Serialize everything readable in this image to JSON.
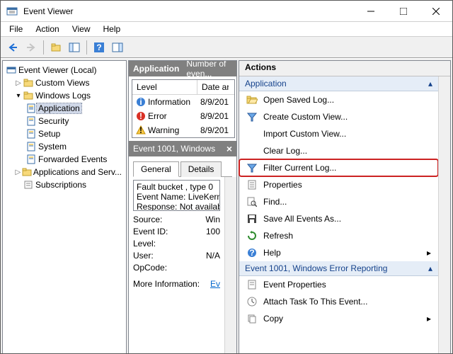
{
  "window": {
    "title": "Event Viewer"
  },
  "menu": {
    "file": "File",
    "action": "Action",
    "view": "View",
    "help": "Help"
  },
  "tree": {
    "root": "Event Viewer (Local)",
    "custom_views": "Custom Views",
    "windows_logs": "Windows Logs",
    "application": "Application",
    "security": "Security",
    "setup": "Setup",
    "system": "System",
    "forwarded": "Forwarded Events",
    "apps_services": "Applications and Serv...",
    "subscriptions": "Subscriptions"
  },
  "mid": {
    "header_title": "Application",
    "header_sub": "Number of even...",
    "col_level": "Level",
    "col_date": "Date ar",
    "rows": [
      {
        "level": "Information",
        "date": "8/9/201"
      },
      {
        "level": "Error",
        "date": "8/9/201"
      },
      {
        "level": "Warning",
        "date": "8/9/201"
      }
    ],
    "detail_title": "Event 1001, Windows",
    "tab_general": "General",
    "tab_details": "Details",
    "detail_lines": {
      "l1": "Fault bucket , type 0",
      "l2": "Event Name: LiveKerne",
      "l3": "Response: Not availabl"
    },
    "kv": {
      "source_k": "Source:",
      "source_v": "Win",
      "eventid_k": "Event ID:",
      "eventid_v": "100",
      "level_k": "Level:",
      "level_v": "",
      "user_k": "User:",
      "user_v": "N/A",
      "opcode_k": "OpCode:",
      "opcode_v": "",
      "more_k": "More Information:",
      "more_v": "Ev"
    }
  },
  "actions": {
    "title": "Actions",
    "group1": "Application",
    "open_saved": "Open Saved Log...",
    "create_view": "Create Custom View...",
    "import_view": "Import Custom View...",
    "clear_log": "Clear Log...",
    "filter": "Filter Current Log...",
    "properties": "Properties",
    "find": "Find...",
    "save_all": "Save All Events As...",
    "refresh": "Refresh",
    "help": "Help",
    "group2": "Event 1001, Windows Error Reporting",
    "event_props": "Event Properties",
    "attach_task": "Attach Task To This Event...",
    "copy": "Copy"
  }
}
